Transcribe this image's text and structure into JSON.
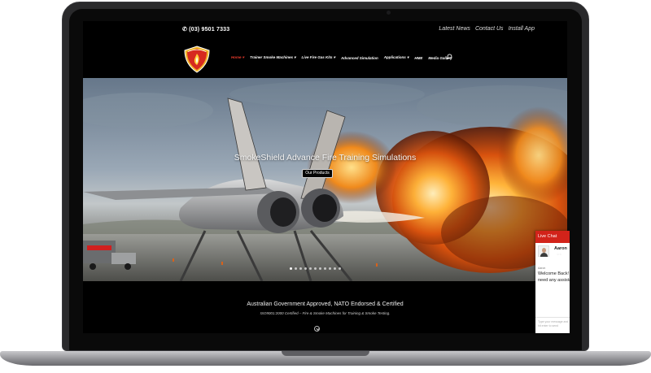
{
  "topbar": {
    "phone": "(03) 9501 7333",
    "links": [
      "Latest News",
      "Contact Us",
      "Install App"
    ]
  },
  "nav": {
    "items": [
      "Home",
      "Trainer Smoke Machines",
      "Live Fire Gas Kits",
      "Advanced Simulation",
      "Applications",
      "HME",
      "Media Gallery"
    ],
    "active_index": 0,
    "dropdown_items": [
      0,
      1,
      2,
      4
    ]
  },
  "hero": {
    "title": "SmokeShield Advance Fire Training Simulations",
    "button": "Our Products",
    "slide_count": 11,
    "active_slide": 0
  },
  "lower": {
    "title": "Australian Government Approved, NATO Endorsed & Certified",
    "subtitle": "ISO9001:2000 Certified – Fire & Smoke Machines for Training & Smoke Testing."
  },
  "chat": {
    "header": "Live Chat",
    "agent_name": "Aaron",
    "message_author": "Aaron",
    "message": "Welcome Back! Do you need any assistance.",
    "input_placeholder": "Type your message and hit enter to send"
  },
  "colors": {
    "accent_red": "#e53b2c",
    "chat_red": "#d2231a",
    "frame": "#2a2a2c"
  },
  "icons": {
    "phone": "phone-icon",
    "search": "search-icon",
    "logo": "smokeshield-shield-logo",
    "down_arrow": "chevron-down-circle-icon"
  }
}
